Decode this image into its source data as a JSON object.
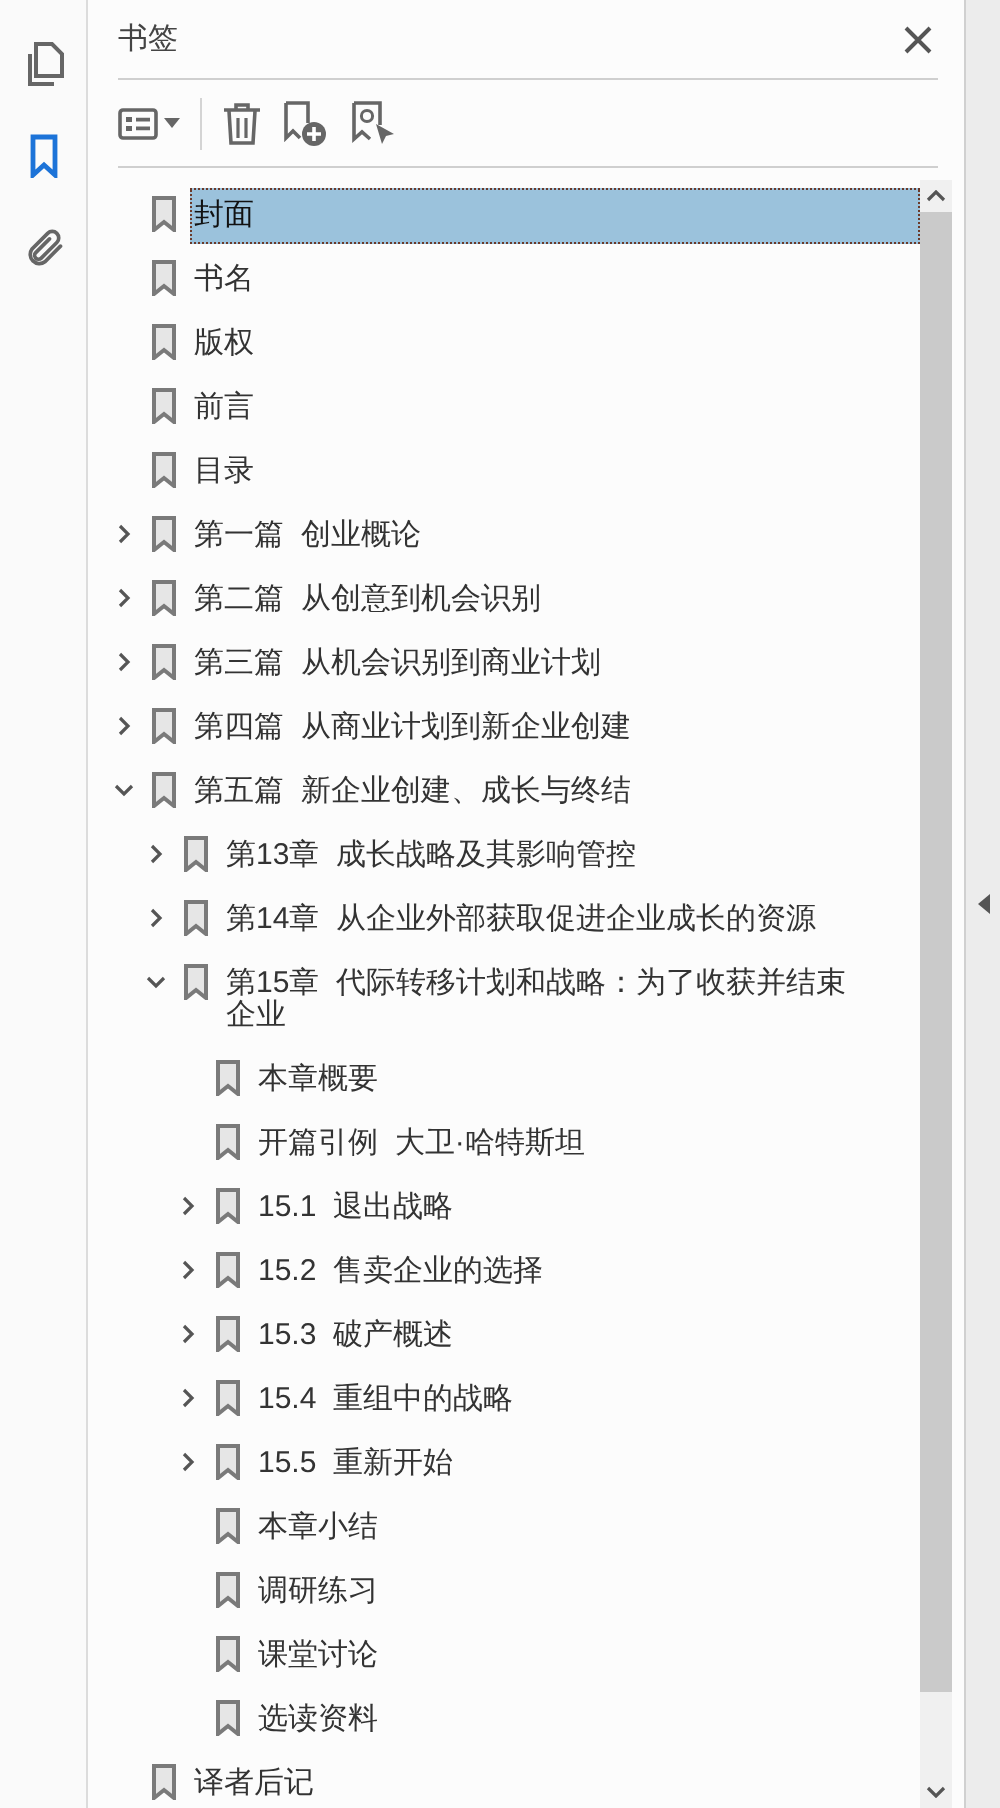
{
  "panel": {
    "title": "书签"
  },
  "bookmarks": [
    {
      "label": "封面",
      "selected": true
    },
    {
      "label": "书名",
      "selected": false
    },
    {
      "label": "版权",
      "selected": false
    },
    {
      "label": "前言",
      "selected": false
    },
    {
      "label": "目录",
      "selected": false
    },
    {
      "label": "第一篇  创业概论",
      "selected": false,
      "expanded": false
    },
    {
      "label": "第二篇  从创意到机会识别",
      "selected": false,
      "expanded": false
    },
    {
      "label": "第三篇  从机会识别到商业计划",
      "selected": false,
      "expanded": false
    },
    {
      "label": "第四篇  从商业计划到新企业创建",
      "selected": false,
      "expanded": false
    },
    {
      "label": "第五篇  新企业创建、成长与终结",
      "selected": false,
      "expanded": true,
      "children": [
        {
          "label": "第13章  成长战略及其影响管控",
          "selected": false,
          "expanded": false
        },
        {
          "label": "第14章  从企业外部获取促进企业成长的资源",
          "selected": false,
          "expanded": false
        },
        {
          "label": "第15章  代际转移计划和战略：为了收获并结束企业",
          "selected": false,
          "expanded": true,
          "children": [
            {
              "label": "本章概要",
              "selected": false
            },
            {
              "label": "开篇引例  大卫·哈特斯坦",
              "selected": false
            },
            {
              "label": "15.1  退出战略",
              "selected": false,
              "expanded": false
            },
            {
              "label": "15.2  售卖企业的选择",
              "selected": false,
              "expanded": false
            },
            {
              "label": "15.3  破产概述",
              "selected": false,
              "expanded": false
            },
            {
              "label": "15.4  重组中的战略",
              "selected": false,
              "expanded": false
            },
            {
              "label": "15.5  重新开始",
              "selected": false,
              "expanded": false
            },
            {
              "label": "本章小结",
              "selected": false
            },
            {
              "label": "调研练习",
              "selected": false
            },
            {
              "label": "课堂讨论",
              "selected": false
            },
            {
              "label": "选读资料",
              "selected": false
            }
          ]
        }
      ]
    },
    {
      "label": "译者后记",
      "selected": false
    }
  ]
}
